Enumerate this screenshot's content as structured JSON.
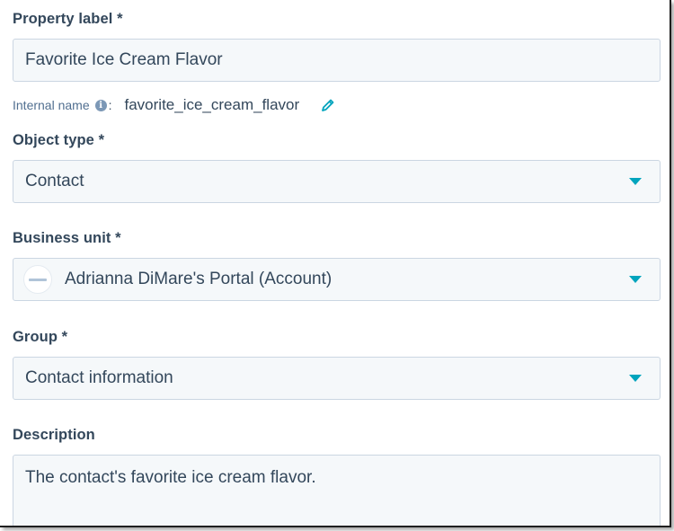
{
  "property_label": {
    "label": "Property label *",
    "value": "Favorite Ice Cream Flavor"
  },
  "internal_name": {
    "label": "Internal name",
    "separator": ":",
    "value": "favorite_ice_cream_flavor",
    "info_icon": "info-icon",
    "edit_icon": "pencil-icon"
  },
  "object_type": {
    "label": "Object type *",
    "value": "Contact",
    "icon": "caret-down-icon"
  },
  "business_unit": {
    "label": "Business unit *",
    "value": "Adrianna DiMare's Portal (Account)",
    "icon": "caret-down-icon"
  },
  "group": {
    "label": "Group *",
    "value": "Contact information",
    "icon": "caret-down-icon"
  },
  "description": {
    "label": "Description",
    "value": "The contact's favorite ice cream flavor."
  },
  "colors": {
    "accent": "#00a4bd",
    "text": "#33475b",
    "field_bg": "#f5f8fa",
    "field_border": "#cbd6e2"
  }
}
